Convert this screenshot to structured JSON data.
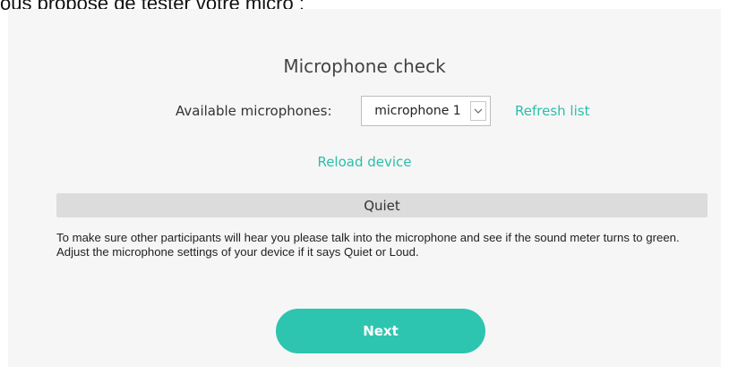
{
  "page": {
    "top_text": "ous propose de tester votre micro :"
  },
  "mic_check": {
    "title": "Microphone check",
    "available_label": "Available microphones:",
    "selected_microphone": "microphone 1",
    "refresh_label": "Refresh list",
    "reload_label": "Reload device",
    "meter_status": "Quiet",
    "meter_level_fraction": 0.0,
    "instructions": "To make sure other participants will hear you please talk into the microphone and see if the sound meter turns to green. Adjust the microphone settings of your device if it says Quiet or Loud.",
    "next_label": "Next"
  },
  "colors": {
    "accent": "#2ec5b0",
    "link": "#2bbfa9",
    "panel_background": "#f6f6f6",
    "meter_background": "#dcdcdc"
  },
  "icons": {
    "select_arrow": "chevron-down-icon"
  }
}
